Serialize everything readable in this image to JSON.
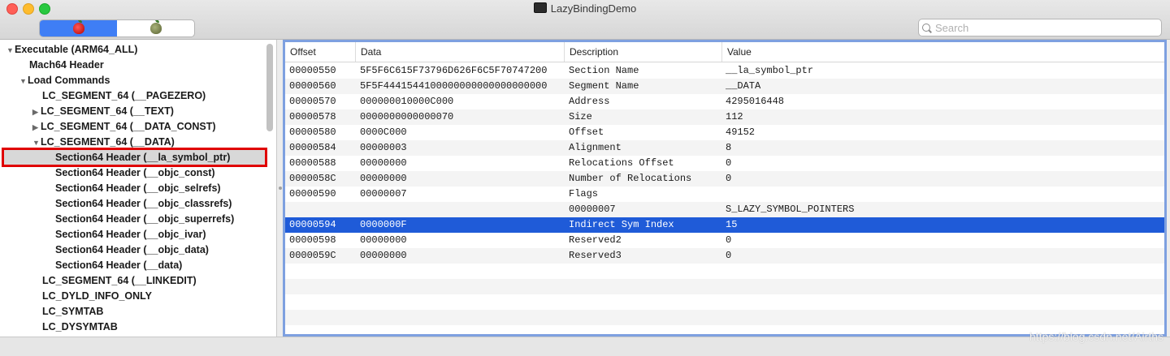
{
  "window": {
    "title": "LazyBindingDemo"
  },
  "search": {
    "placeholder": "Search"
  },
  "tree": [
    {
      "label": "Executable  (ARM64_ALL)",
      "arrow": "▼"
    },
    {
      "label": "Mach64 Header",
      "arrow": ""
    },
    {
      "label": "Load Commands",
      "arrow": "▼"
    },
    {
      "label": "LC_SEGMENT_64 (__PAGEZERO)",
      "arrow": ""
    },
    {
      "label": "LC_SEGMENT_64 (__TEXT)",
      "arrow": "▶"
    },
    {
      "label": "LC_SEGMENT_64 (__DATA_CONST)",
      "arrow": "▶"
    },
    {
      "label": "LC_SEGMENT_64 (__DATA)",
      "arrow": "▼"
    },
    {
      "label": "Section64 Header (__la_symbol_ptr)",
      "arrow": ""
    },
    {
      "label": "Section64 Header (__objc_const)",
      "arrow": ""
    },
    {
      "label": "Section64 Header (__objc_selrefs)",
      "arrow": ""
    },
    {
      "label": "Section64 Header (__objc_classrefs)",
      "arrow": ""
    },
    {
      "label": "Section64 Header (__objc_superrefs)",
      "arrow": ""
    },
    {
      "label": "Section64 Header (__objc_ivar)",
      "arrow": ""
    },
    {
      "label": "Section64 Header (__objc_data)",
      "arrow": ""
    },
    {
      "label": "Section64 Header (__data)",
      "arrow": ""
    },
    {
      "label": "LC_SEGMENT_64 (__LINKEDIT)",
      "arrow": ""
    },
    {
      "label": "LC_DYLD_INFO_ONLY",
      "arrow": ""
    },
    {
      "label": "LC_SYMTAB",
      "arrow": ""
    },
    {
      "label": "LC_DYSYMTAB",
      "arrow": ""
    }
  ],
  "table": {
    "headers": [
      "Offset",
      "Data",
      "Description",
      "Value"
    ],
    "rows": [
      [
        "00000550",
        "5F5F6C615F73796D626F6C5F70747200",
        "Section Name",
        "__la_symbol_ptr"
      ],
      [
        "00000560",
        "5F5F4441544100000000000000000000",
        "Segment Name",
        "__DATA"
      ],
      [
        "00000570",
        "000000010000C000",
        "Address",
        "4295016448"
      ],
      [
        "00000578",
        "0000000000000070",
        "Size",
        "112"
      ],
      [
        "00000580",
        "0000C000",
        "Offset",
        "49152"
      ],
      [
        "00000584",
        "00000003",
        "Alignment",
        "8"
      ],
      [
        "00000588",
        "00000000",
        "Relocations Offset",
        "0"
      ],
      [
        "0000058C",
        "00000000",
        "Number of Relocations",
        "0"
      ],
      [
        "00000590",
        "00000007",
        "Flags",
        ""
      ],
      [
        "",
        "",
        "00000007",
        "S_LAZY_SYMBOL_POINTERS"
      ],
      [
        "00000594",
        "0000000F",
        "Indirect Sym Index",
        "15"
      ],
      [
        "00000598",
        "00000000",
        "Reserved2",
        "0"
      ],
      [
        "0000059C",
        "00000000",
        "Reserved3",
        "0"
      ]
    ]
  },
  "watermark": "https://blog.csdn.net/Airths"
}
